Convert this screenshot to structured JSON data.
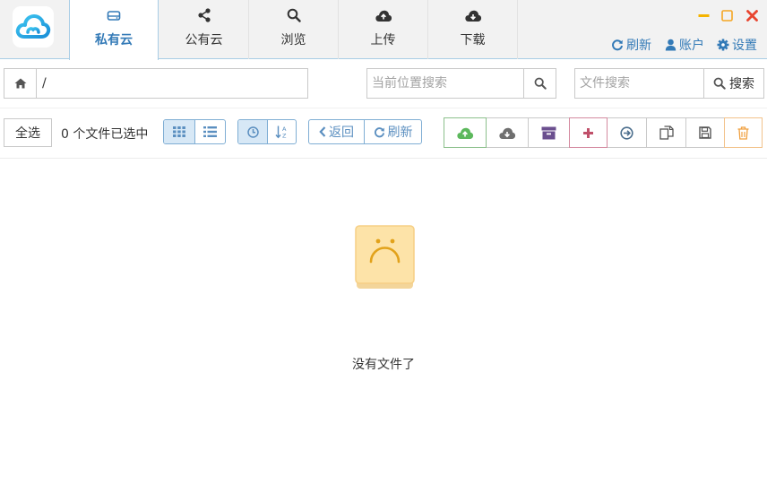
{
  "header": {
    "tabs": [
      {
        "label": "私有云",
        "icon": "hdd-icon",
        "active": true
      },
      {
        "label": "公有云",
        "icon": "share-icon",
        "active": false
      },
      {
        "label": "浏览",
        "icon": "search-icon",
        "active": false
      },
      {
        "label": "上传",
        "icon": "cloud-upload-icon",
        "active": false
      },
      {
        "label": "下载",
        "icon": "cloud-download-icon",
        "active": false
      }
    ],
    "links": {
      "refresh": "刷新",
      "account": "账户",
      "settings": "设置"
    },
    "accent_color": "#337ab7",
    "window_controls": {
      "minimize_color": "#f5b400",
      "maximize_color": "#f5a623",
      "close_color": "#e8452f"
    }
  },
  "address": {
    "path": "/",
    "location_search_placeholder": "当前位置搜索",
    "file_search_placeholder": "文件搜索",
    "file_search_button": "搜索"
  },
  "toolbar": {
    "select_all": "全选",
    "selection_status": "0 个文件已选中",
    "view_modes": [
      "grid-view-icon",
      "list-view-icon"
    ],
    "sort_modes": [
      "clock-icon",
      "sort-alpha-icon"
    ],
    "back": "返回",
    "refresh": "刷新",
    "actions": [
      {
        "icon": "cloud-upload-icon",
        "color": "#5cb85c"
      },
      {
        "icon": "cloud-download-icon",
        "color": "#6f6f6f"
      },
      {
        "icon": "archive-icon",
        "color": "#6b4f8f"
      },
      {
        "icon": "plus-icon",
        "color": "#c0506a"
      },
      {
        "icon": "arrow-circle-right-icon",
        "color": "#4a6d8c"
      },
      {
        "icon": "copy-icon",
        "color": "#555555"
      },
      {
        "icon": "save-icon",
        "color": "#555555"
      },
      {
        "icon": "trash-icon",
        "color": "#f0a040"
      }
    ]
  },
  "main": {
    "empty_message": "没有文件了",
    "empty_icon": "sad-box-icon"
  }
}
